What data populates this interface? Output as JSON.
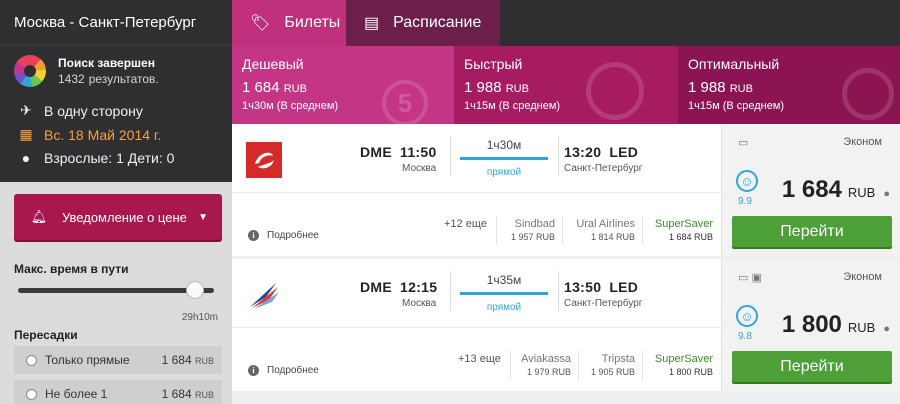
{
  "sidebar": {
    "route": "Москва - Санкт-Петербург",
    "status_title": "Поиск завершен",
    "results_count": "1432",
    "results_suffix": "результатов.",
    "trip_type": "В одну сторону",
    "date": "Вс. 18 Май 2014 г.",
    "passengers": "Взрослые: 1 Дети: 0",
    "notify_label": "Уведомление о цене",
    "max_time_label": "Макс. время в пути",
    "max_time_value": "29h10m",
    "max_time_fraction": 1.0,
    "stops_label": "Пересадки",
    "stops": [
      {
        "label": "Только прямые",
        "price": "1 684",
        "currency": "RUB"
      },
      {
        "label": "Не более 1",
        "price": "1 684",
        "currency": "RUB"
      }
    ]
  },
  "tabs": [
    {
      "label": "Билеты",
      "icon": "ticket-icon",
      "active": true
    },
    {
      "label": "Расписание",
      "icon": "calendar-icon",
      "active": false
    }
  ],
  "categories": [
    {
      "label": "Дешевый",
      "price": "1 684",
      "currency": "RUB",
      "duration": "1ч30м (В среднем)",
      "deco": "5"
    },
    {
      "label": "Быстрый",
      "price": "1 988",
      "currency": "RUB",
      "duration": "1ч15м (В среднем)"
    },
    {
      "label": "Оптимальный",
      "price": "1 988",
      "currency": "RUB",
      "duration": "1ч15м (В среднем)"
    }
  ],
  "flights": [
    {
      "airline_logo": "s7-logo",
      "dep_code": "DME",
      "dep_time": "11:50",
      "dep_city": "Москва",
      "duration": "1ч30м",
      "direct": "прямой",
      "arr_time": "13:20",
      "arr_code": "LED",
      "arr_city": "Санкт-Петербург",
      "more_label": "Подробнее",
      "extra": "+12 еще",
      "agencies": [
        {
          "name": "Sindbad",
          "price": "1 957 RUB"
        },
        {
          "name": "Ural Airlines",
          "price": "1 814 RUB"
        },
        {
          "name": "SuperSaver",
          "price": "1 684 RUB"
        }
      ],
      "class": "Эконом",
      "rating": "9.9",
      "price": "1 684",
      "currency": "RUB",
      "button": "Перейти"
    },
    {
      "airline_logo": "aeroflot-logo",
      "dep_code": "DME",
      "dep_time": "12:15",
      "dep_city": "Москва",
      "duration": "1ч35м",
      "direct": "прямой",
      "arr_time": "13:50",
      "arr_code": "LED",
      "arr_city": "Санкт-Петербург",
      "more_label": "Подробнее",
      "extra": "+13 еще",
      "agencies": [
        {
          "name": "Aviakassa",
          "price": "1 979 RUB"
        },
        {
          "name": "Tripsta",
          "price": "1 905 RUB"
        },
        {
          "name": "SuperSaver",
          "price": "1 800 RUB"
        }
      ],
      "class": "Эконом",
      "rating": "9.8",
      "price": "1 800",
      "currency": "RUB",
      "button": "Перейти"
    }
  ],
  "colors": {
    "accent_pink": "#c0307d",
    "accent_dark": "#6b1f4a",
    "green_button": "#4ca037",
    "blue_line": "#2fa5d8",
    "date_orange": "#f7a23b"
  }
}
